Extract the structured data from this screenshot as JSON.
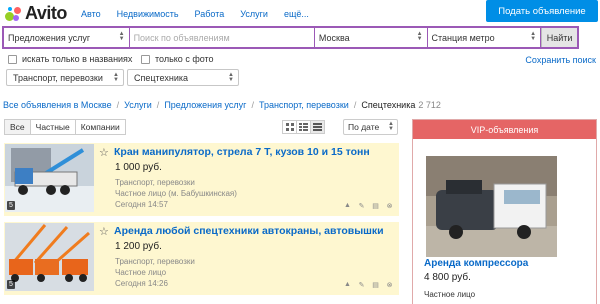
{
  "header": {
    "logo_text": "Avito",
    "nav": [
      "Авто",
      "Недвижимость",
      "Работа",
      "Услуги",
      "ещё..."
    ],
    "post_button": "Подать объявление",
    "logo_colors": [
      "#97cf26",
      "#a169f7",
      "#ff6163",
      "#0af"
    ]
  },
  "search": {
    "category": "Предложения услуг",
    "query_placeholder": "Поиск по объявлениям",
    "city": "Москва",
    "metro": "Станция метро",
    "find_button": "Найти"
  },
  "filters": {
    "titles_only": "искать только в названиях",
    "with_photo": "только с фото",
    "save_search": "Сохранить поиск",
    "subcategory": "Транспорт, перевозки",
    "type": "Спецтехника"
  },
  "breadcrumbs": {
    "items": [
      "Все объявления в Москве",
      "Услуги",
      "Предложения услуг",
      "Транспорт, перевозки"
    ],
    "current": "Спецтехника",
    "count": "2 712"
  },
  "tabs": [
    "Все",
    "Частные",
    "Компании"
  ],
  "sort": "По дате",
  "listings": [
    {
      "title": "Кран манипулятор, стрела 7 Т, кузов 10 и 15 тонн",
      "price": "1 000 руб.",
      "category": "Транспорт, перевозки",
      "seller": "Частное лицо (м. Бабушкинская)",
      "date": "Сегодня 14:57",
      "photos": "5"
    },
    {
      "title": "Аренда любой спецтехники автокраны, автовышки",
      "price": "1 200 руб.",
      "category": "Транспорт, перевозки",
      "seller": "Частное лицо",
      "date": "Сегодня 14:26",
      "photos": "5"
    }
  ],
  "vip": {
    "header": "VIP-объявления",
    "title": "Аренда компрессора",
    "price": "4 800 руб.",
    "seller": "Частное лицо"
  },
  "colors": {
    "link": "#0a6ac8",
    "accent_button": "#008ee6",
    "search_border": "#9b59b6",
    "listing_bg": "#fef7d0",
    "vip_header": "#e56565"
  }
}
